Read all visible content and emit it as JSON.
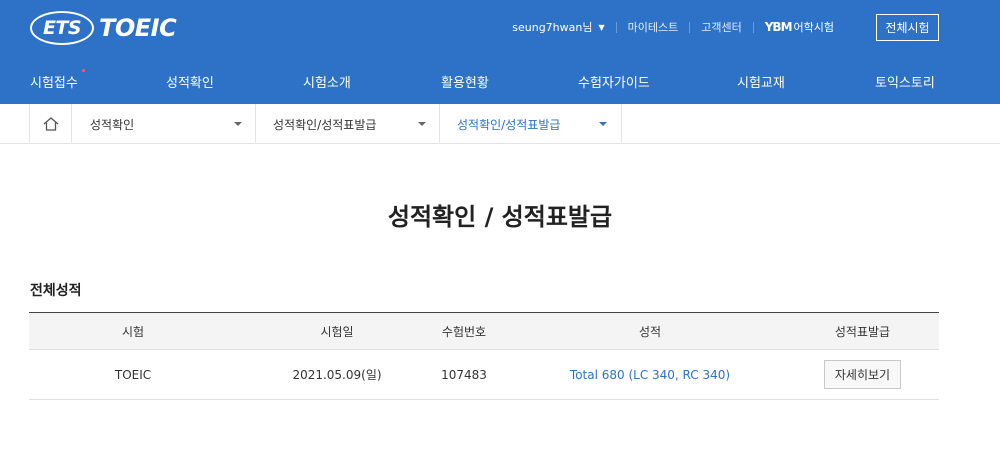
{
  "brand": {
    "ets": "ETS",
    "toeic": "TOEIC"
  },
  "util": {
    "username": "seung7hwan님",
    "mytest": "마이테스트",
    "support": "고객센터",
    "ycm_mark": "YBM",
    "ycm_label": "어학시험",
    "all_tests_button": "전체시험"
  },
  "nav": [
    {
      "label": "시험접수"
    },
    {
      "label": "성적확인"
    },
    {
      "label": "시험소개"
    },
    {
      "label": "활용현황"
    },
    {
      "label": "수험자가이드"
    },
    {
      "label": "시험교재"
    },
    {
      "label": "토익스토리"
    }
  ],
  "breadcrumb": {
    "level1": "성적확인",
    "level2": "성적확인/성적표발급",
    "level3": "성적확인/성적표발급"
  },
  "page_title": "성적확인 / 성적표발급",
  "section_title": "전체성적",
  "table": {
    "headers": [
      "시험",
      "시험일",
      "수험번호",
      "성적",
      "성적표발급"
    ],
    "rows": [
      {
        "test": "TOEIC",
        "date": "2021.05.09(일)",
        "reg_no": "107483",
        "score": "Total 680 (LC 340, RC 340)",
        "action": "자세히보기"
      }
    ]
  },
  "colors": {
    "primary": "#2d72c7",
    "new_dot": "#ff5a5a"
  }
}
